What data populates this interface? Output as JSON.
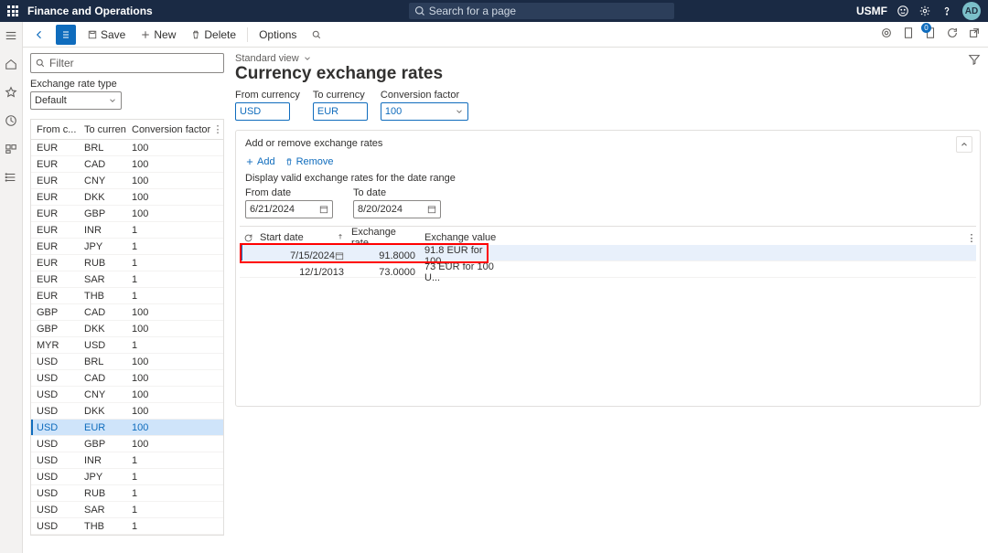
{
  "header": {
    "app_title": "Finance and Operations",
    "search_placeholder": "Search for a page",
    "company": "USMF",
    "avatar_initials": "AD"
  },
  "toolbar": {
    "save": "Save",
    "new": "New",
    "delete": "Delete",
    "options": "Options",
    "badge": "0"
  },
  "left": {
    "filter_placeholder": "Filter",
    "rate_type_label": "Exchange rate type",
    "rate_type_value": "Default",
    "columns": {
      "from": "From c...",
      "to": "To currency",
      "factor": "Conversion factor"
    },
    "rows": [
      {
        "from": "EUR",
        "to": "BRL",
        "factor": "100"
      },
      {
        "from": "EUR",
        "to": "CAD",
        "factor": "100"
      },
      {
        "from": "EUR",
        "to": "CNY",
        "factor": "100"
      },
      {
        "from": "EUR",
        "to": "DKK",
        "factor": "100"
      },
      {
        "from": "EUR",
        "to": "GBP",
        "factor": "100"
      },
      {
        "from": "EUR",
        "to": "INR",
        "factor": "1"
      },
      {
        "from": "EUR",
        "to": "JPY",
        "factor": "1"
      },
      {
        "from": "EUR",
        "to": "RUB",
        "factor": "1"
      },
      {
        "from": "EUR",
        "to": "SAR",
        "factor": "1"
      },
      {
        "from": "EUR",
        "to": "THB",
        "factor": "1"
      },
      {
        "from": "GBP",
        "to": "CAD",
        "factor": "100"
      },
      {
        "from": "GBP",
        "to": "DKK",
        "factor": "100"
      },
      {
        "from": "MYR",
        "to": "USD",
        "factor": "1"
      },
      {
        "from": "USD",
        "to": "BRL",
        "factor": "100"
      },
      {
        "from": "USD",
        "to": "CAD",
        "factor": "100"
      },
      {
        "from": "USD",
        "to": "CNY",
        "factor": "100"
      },
      {
        "from": "USD",
        "to": "DKK",
        "factor": "100"
      },
      {
        "from": "USD",
        "to": "EUR",
        "factor": "100",
        "selected": true
      },
      {
        "from": "USD",
        "to": "GBP",
        "factor": "100"
      },
      {
        "from": "USD",
        "to": "INR",
        "factor": "1"
      },
      {
        "from": "USD",
        "to": "JPY",
        "factor": "1"
      },
      {
        "from": "USD",
        "to": "RUB",
        "factor": "1"
      },
      {
        "from": "USD",
        "to": "SAR",
        "factor": "1"
      },
      {
        "from": "USD",
        "to": "THB",
        "factor": "1"
      }
    ]
  },
  "main": {
    "view": "Standard view",
    "title": "Currency exchange rates",
    "fields": {
      "from_label": "From currency",
      "from_value": "USD",
      "to_label": "To currency",
      "to_value": "EUR",
      "factor_label": "Conversion factor",
      "factor_value": "100"
    },
    "detail_title": "Add or remove exchange rates",
    "add": "Add",
    "remove": "Remove",
    "hint": "Display valid exchange rates for the date range",
    "from_date_label": "From date",
    "from_date_value": "6/21/2024",
    "to_date_label": "To date",
    "to_date_value": "8/20/2024",
    "rate_cols": {
      "start": "Start date",
      "rate": "Exchange rate",
      "value": "Exchange value"
    },
    "rate_rows": [
      {
        "start": "7/15/2024",
        "rate": "91.8000",
        "value": "91.8 EUR for 100 ...",
        "selected": true,
        "calendar": true
      },
      {
        "start": "12/1/2013",
        "rate": "73.0000",
        "value": "73 EUR for 100 U..."
      }
    ]
  }
}
